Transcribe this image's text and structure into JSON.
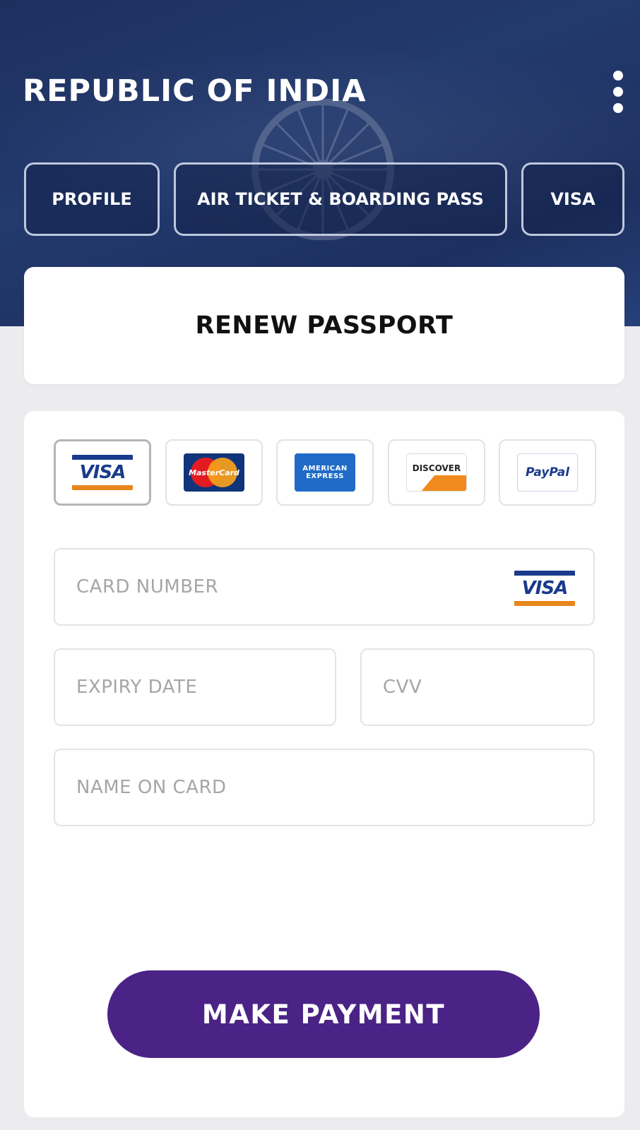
{
  "header": {
    "title": "REPUBLIC OF INDIA",
    "menu_icon": "more-vertical-icon",
    "background_color": "#1e2f5e"
  },
  "tabs": [
    {
      "label": "PROFILE"
    },
    {
      "label": "AIR TICKET & BOARDING PASS"
    },
    {
      "label": "VISA"
    }
  ],
  "renew": {
    "title": "RENEW PASSPORT"
  },
  "payment": {
    "methods": [
      {
        "name": "visa-logo",
        "label": "VISA",
        "selected": true
      },
      {
        "name": "mastercard-logo",
        "label": "MasterCard",
        "selected": false
      },
      {
        "name": "amex-logo",
        "label": "AMERICAN EXPRESS",
        "selected": false
      },
      {
        "name": "discover-logo",
        "label": "DISCOVER",
        "selected": false
      },
      {
        "name": "paypal-logo",
        "label": "PayPal",
        "selected": false
      }
    ],
    "fields": {
      "card_number": {
        "placeholder": "CARD NUMBER",
        "value": ""
      },
      "expiry": {
        "placeholder": "EXPIRY DATE",
        "value": ""
      },
      "cvv": {
        "placeholder": "CVV",
        "value": ""
      },
      "name": {
        "placeholder": "NAME ON CARD",
        "value": ""
      }
    },
    "card_brand_label": "VISA",
    "submit_label": "MAKE PAYMENT",
    "accent_color": "#4b2386"
  }
}
